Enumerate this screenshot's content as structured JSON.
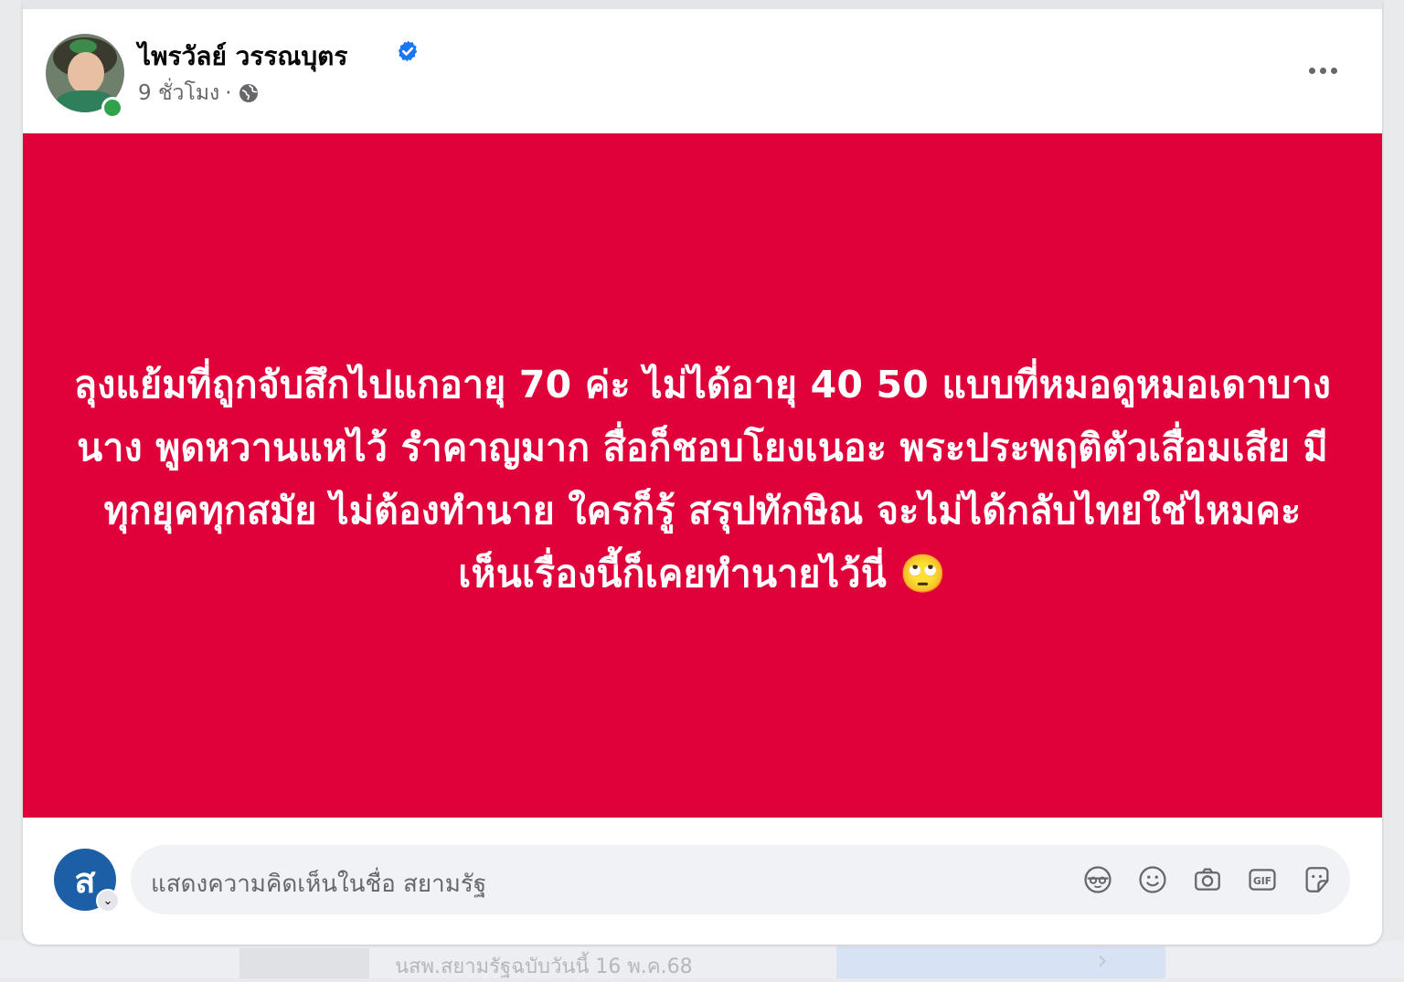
{
  "post": {
    "author_name": "ไพรวัลย์ วรรณบุตร",
    "time": "9 ชั่วโมง",
    "separator": "·",
    "verified": true,
    "privacy_icon": "globe-icon",
    "more_icon": "more-options-icon",
    "text": "ลุงแย้มที่ถูกจับสึกไปแกอายุ 70 ค่ะ ไม่ได้อายุ 40 50 แบบที่หมอดูหมอเดาบางนาง พูดหวานแหไว้ รำคาญมาก สื่อก็ชอบโยงเนอะ  พระประพฤติตัวเสื่อมเสีย  มีทุกยุคทุกสมัย ไม่ต้องทำนาย ใครก็รู้ สรุปทักษิณ จะไม่ได้กลับไทยใช่ไหมคะ เห็นเรื่องนี้ก็เคยทำนายไว้นี่ 🙄",
    "background_color": "#e0003a"
  },
  "comment": {
    "avatar_letter": "ส",
    "placeholder": "แสดงความคิดเห็นในชื่อ สยามรัฐ",
    "icons": [
      "avatar-sticker-icon",
      "emoji-icon",
      "camera-icon",
      "gif-icon",
      "sticker-icon"
    ],
    "icon_gif_label": "GIF"
  },
  "background": {
    "caption": "นสพ.สยามรัฐฉบับวันนี้ 16 พ.ค.68"
  }
}
